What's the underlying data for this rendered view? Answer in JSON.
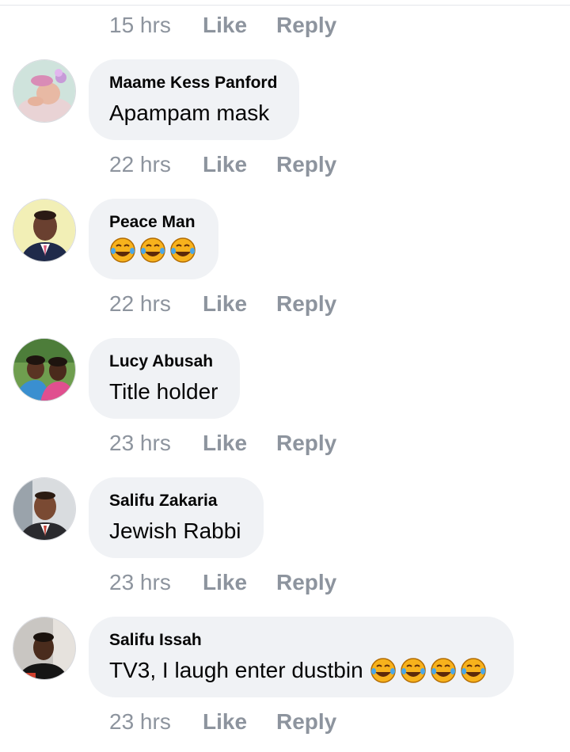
{
  "actions": {
    "like": "Like",
    "reply": "Reply"
  },
  "colors": {
    "bubble": "#f0f2f5",
    "meta": "#8d949e",
    "text": "#050505"
  },
  "top_row": {
    "time": "15 hrs"
  },
  "comments": [
    {
      "author": "Maame Kess Panford",
      "text": "Apampam mask",
      "emoji": "",
      "time": "22 hrs",
      "avatar_icon": "baby-photo"
    },
    {
      "author": "Peace Man",
      "text": "",
      "emoji": "🤣🤣🤣",
      "time": "22 hrs",
      "avatar_icon": "man-portrait"
    },
    {
      "author": "Lucy Abusah",
      "text": "Title holder",
      "emoji": "",
      "time": "23 hrs",
      "avatar_icon": "two-women-photo"
    },
    {
      "author": "Salifu Zakaria",
      "text": "Jewish Rabbi",
      "emoji": "",
      "time": "23 hrs",
      "avatar_icon": "man-suit-photo"
    },
    {
      "author": "Salifu Issah",
      "text": "TV3, I laugh enter dustbin",
      "emoji": "🤣🤣🤣🤣",
      "time": "23 hrs",
      "avatar_icon": "young-man-photo"
    }
  ]
}
